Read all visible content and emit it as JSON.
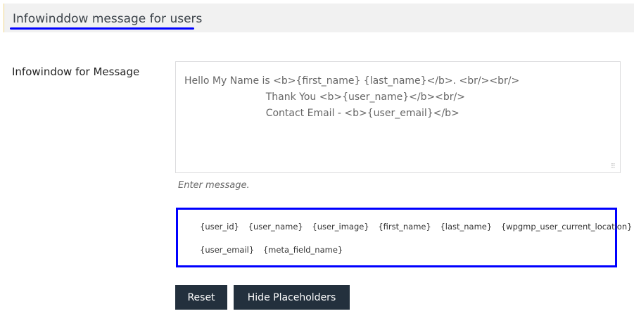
{
  "header": {
    "title": "Infowinddow message for users"
  },
  "field": {
    "label": "Infowindow for Message",
    "value": "Hello My Name is <b>{first_name} {last_name}</b>. <br/><br/>\n                          Thank You <b>{user_name}</b><br/>\n                          Contact Email - <b>{user_email}</b>",
    "hint": "Enter message."
  },
  "placeholders": {
    "row1": [
      "{user_id}",
      "{user_name}",
      "{user_image}",
      "{first_name}",
      "{last_name}",
      "{wpgmp_user_current_location}"
    ],
    "row2": [
      "{user_email}",
      "{meta_field_name}"
    ]
  },
  "buttons": {
    "reset": "Reset",
    "hide": "Hide Placeholders"
  },
  "colors": {
    "highlight": "#0000ff",
    "button": "#23303d"
  }
}
